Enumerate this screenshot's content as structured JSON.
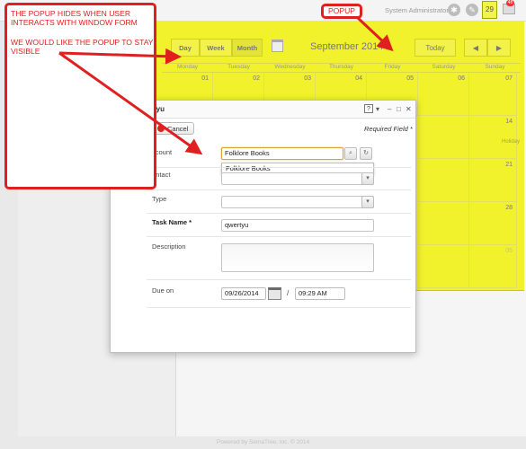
{
  "header": {
    "user": "System Administrator",
    "calendar_badge": "29",
    "mail_badge": "48"
  },
  "footer": "Powered by SemaTree, Inc. © 2014",
  "calendar": {
    "view_day": "Day",
    "view_week": "Week",
    "view_month": "Month",
    "active_view": "Month",
    "month_title": "September 2014",
    "today_label": "Today",
    "prev_label": "◀",
    "next_label": "▶",
    "weekdays": [
      "Monday",
      "Tuesday",
      "Wednesday",
      "Thursday",
      "Friday",
      "Saturday",
      "Sunday"
    ],
    "row1": [
      "01",
      "02",
      "03",
      "04",
      "05",
      "06",
      "07"
    ],
    "row2_sunday": "14",
    "holiday_label": "Holiday",
    "row3_sunday": "21",
    "row4_sunday": "28",
    "row5_sunday": "05",
    "bg_color": "#f1f12c"
  },
  "form": {
    "title": "tyu",
    "cancel_label": "Cancel",
    "required_note": "Required Field *",
    "account_label": "ccount",
    "account_value": "Folklore Books",
    "account_suggestion": "Folklore Books",
    "contact_label": "ontact",
    "type_label": "Type",
    "task_name_label": "Task Name *",
    "task_name_value": "qwertyu",
    "description_label": "Description",
    "due_on_label": "Due on",
    "due_date": "09/26/2014",
    "due_time": "09:29 AM",
    "date_separator": "/"
  },
  "annotations": {
    "note_line1": "THE POPUP HIDES WHEN USER INTERACTS WITH WINDOW FORM",
    "note_line2": "WE WOULD LIKE THE POPUP TO STAY VISIBLE",
    "popup_label": "POPUP",
    "color": "#e02020"
  }
}
